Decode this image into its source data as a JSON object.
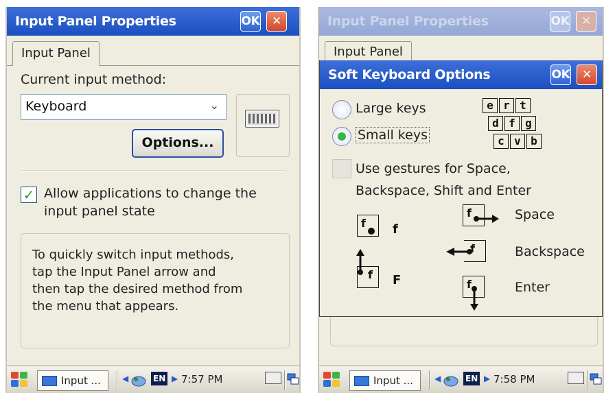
{
  "left": {
    "title": "Input Panel Properties",
    "ok_label": "OK",
    "close_label": "✕",
    "tab_label": "Input Panel",
    "current_method_label": "Current input method:",
    "method_value": "Keyboard",
    "options_button": "Options...",
    "allow_checkbox_label_line1": "Allow applications to change the",
    "allow_checkbox_label_line2": "input panel state",
    "allow_checked": true,
    "info_line1": "To quickly switch input methods,",
    "info_line2": "tap the Input Panel arrow and",
    "info_line3": "then tap the desired method from",
    "info_line4": "the menu that appears.",
    "taskbar_item": "Input ...",
    "lang": "EN",
    "time": "7:57 PM"
  },
  "right": {
    "bg_title": "Input Panel Properties",
    "ok_label": "OK",
    "close_label": "✕",
    "bg_tab_label": "Input Panel",
    "dialog_title": "Soft Keyboard Options",
    "large_keys_label": "Large keys",
    "small_keys_label": "Small keys",
    "selected_option": "Small keys",
    "keys_row1": [
      "e",
      "r",
      "t"
    ],
    "keys_row2": [
      "d",
      "f",
      "g"
    ],
    "keys_row3": [
      "c",
      "v",
      "b"
    ],
    "gestures_label_line1": "Use gestures for Space,",
    "gestures_label_line2": "Backspace, Shift and Enter",
    "gestures_checked": false,
    "gesture_key_char": "f",
    "gesture_f_lower": "f",
    "gesture_f_upper": "F",
    "gesture_space": "Space",
    "gesture_backspace": "Backspace",
    "gesture_enter": "Enter",
    "taskbar_item": "Input ...",
    "lang": "EN",
    "time": "7:58 PM"
  }
}
